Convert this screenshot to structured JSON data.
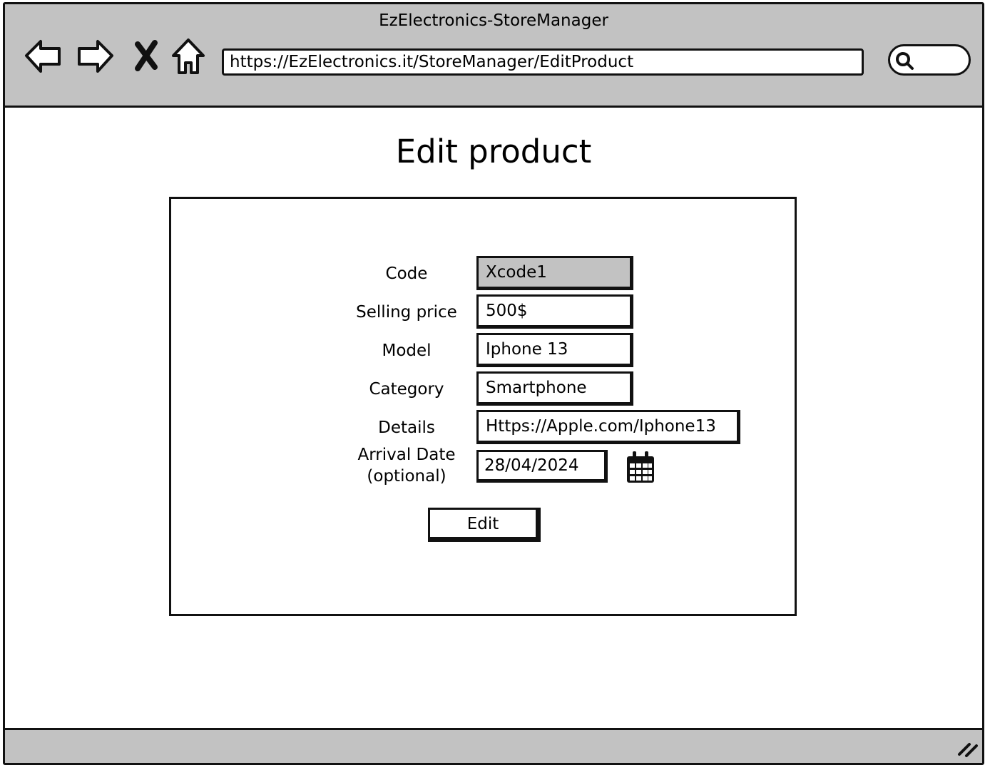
{
  "window": {
    "title": "EzElectronics-StoreManager",
    "url": "https://EzElectronics.it/StoreManager/EditProduct",
    "nav_icons": [
      "back-arrow-icon",
      "forward-arrow-icon",
      "close-icon",
      "home-icon"
    ],
    "search_value": ""
  },
  "page": {
    "heading": "Edit product"
  },
  "form": {
    "code": {
      "label": "Code",
      "value": "Xcode1"
    },
    "selling_price": {
      "label": "Selling price",
      "value": "500$"
    },
    "model": {
      "label": "Model",
      "value": "Iphone 13"
    },
    "category": {
      "label": "Category",
      "value": "Smartphone"
    },
    "details": {
      "label": "Details",
      "value": "Https://Apple.com/Iphone13"
    },
    "arrival_date": {
      "label_line1": "Arrival Date",
      "label_line2": "(optional)",
      "value": "28/04/2024"
    },
    "submit_label": "Edit"
  },
  "colors": {
    "chrome": "#c2c2c2",
    "readonly_field": "#c2c2c2",
    "border": "#111111",
    "background": "#ffffff"
  }
}
